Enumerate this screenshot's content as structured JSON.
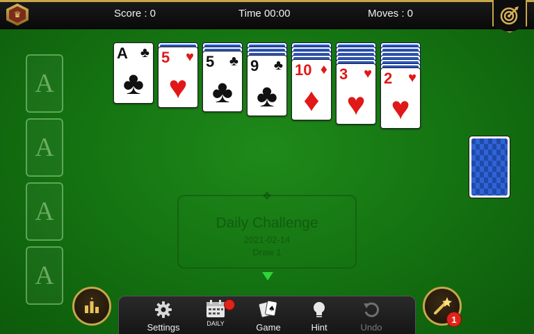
{
  "header": {
    "score_label": "Score : 0",
    "time_label": "Time 00:00",
    "moves_label": "Moves : 0"
  },
  "foundations": [
    {
      "label": "A"
    },
    {
      "label": "A"
    },
    {
      "label": "A"
    },
    {
      "label": "A"
    }
  ],
  "tableau": [
    {
      "rank": "A",
      "suit": "♣",
      "color": "black",
      "hidden": 0
    },
    {
      "rank": "5",
      "suit": "♥",
      "color": "red",
      "hidden": 1
    },
    {
      "rank": "5",
      "suit": "♣",
      "color": "black",
      "hidden": 2
    },
    {
      "rank": "9",
      "suit": "♣",
      "color": "black",
      "hidden": 3
    },
    {
      "rank": "10",
      "suit": "♦",
      "color": "red",
      "hidden": 4
    },
    {
      "rank": "3",
      "suit": "♥",
      "color": "red",
      "hidden": 5
    },
    {
      "rank": "2",
      "suit": "♥",
      "color": "red",
      "hidden": 6
    }
  ],
  "daily": {
    "title": "Daily Challenge",
    "date": "2021-02-14",
    "draw": "Draw 1"
  },
  "toolbar": {
    "settings": "Settings",
    "daily": "DAILY",
    "game": "Game",
    "hint": "Hint",
    "undo": "Undo"
  },
  "badges": {
    "magic_count": "1"
  },
  "colors": {
    "felt": "#157512",
    "gold": "#c9a64a",
    "red_suit": "#e01818",
    "card_back": "#2a57c8",
    "notification": "#e0241c",
    "arrow": "#2fd43a"
  }
}
